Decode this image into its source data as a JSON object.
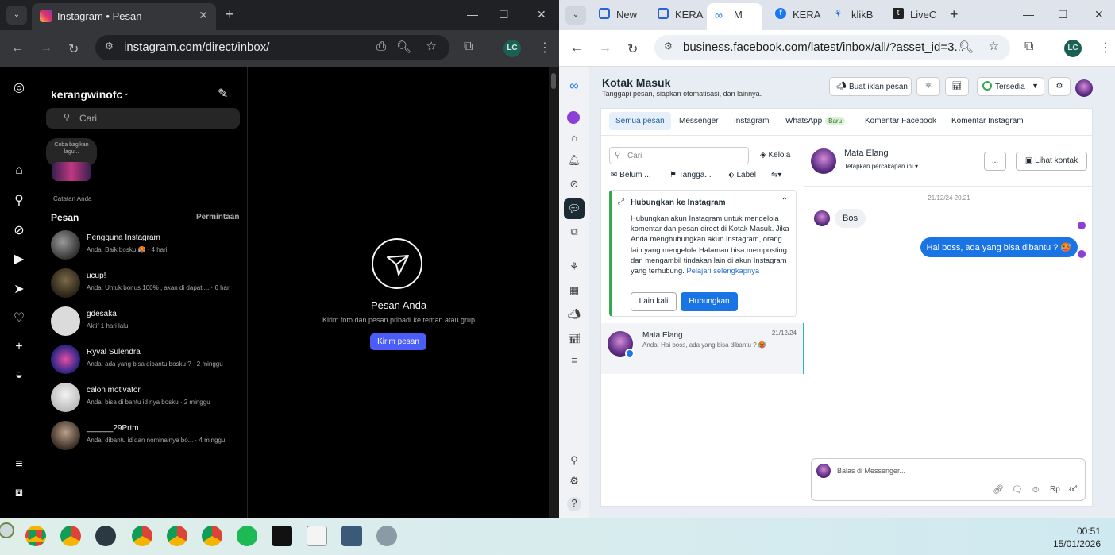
{
  "left_browser": {
    "tab_title": "Instagram • Pesan",
    "url": "instagram.com/direct/inbox/",
    "profile_initials": "LC"
  },
  "instagram": {
    "username": "kerangwinofc",
    "search_placeholder": "Cari",
    "note_bubble": "Coba bagikan lagu...",
    "note_label": "Catatan Anda",
    "messages_header": "Pesan",
    "requests_label": "Permintaan",
    "threads": [
      {
        "name": "Pengguna Instagram",
        "preview": "Anda: Baik bosku 🥵 · 4 hari"
      },
      {
        "name": "ucup!",
        "preview": "Anda: Untuk bonus 100% , akan di dapat ... · 6 hari"
      },
      {
        "name": "gdesaka",
        "preview": "Aktif 1 hari lalu"
      },
      {
        "name": "Ryval Sulendra",
        "preview": "Anda: ada yang bisa dibantu bosku ? · 2 minggu"
      },
      {
        "name": "calon motivator",
        "preview": "Anda: bisa di bantu id nya bosku · 2 minggu"
      },
      {
        "name": "______29Prtm",
        "preview": "Anda: dibantu id dan nominalnya bo... · 4 minggu"
      }
    ],
    "empty_title": "Pesan Anda",
    "empty_desc": "Kirim foto dan pesan pribadi ke teman atau grup",
    "send_button": "Kirim pesan"
  },
  "right_browser": {
    "tabs": [
      "New",
      "KERA",
      "M",
      "KERA",
      "klikB",
      "LiveC"
    ],
    "url": "business.facebook.com/latest/inbox/all/?asset_id=3...",
    "profile_initials": "LC"
  },
  "fb": {
    "title": "Kotak Masuk",
    "subtitle": "Tanggapi pesan, siapkan otomatisasi, dan lainnya.",
    "ad_button": "Buat iklan pesan",
    "status": "Tersedia",
    "tabs": [
      "Semua pesan",
      "Messenger",
      "Instagram",
      "WhatsApp",
      "Komentar Facebook",
      "Komentar Instagram"
    ],
    "baru": "Baru",
    "search_placeholder": "Cari",
    "kelola": "Kelola",
    "filters": [
      "Belum ...",
      "Tangga...",
      "Label"
    ],
    "connect_title": "Hubungkan ke Instagram",
    "connect_body": "Hubungkan akun Instagram untuk mengelola komentar dan pesan direct di Kotak Masuk. Jika Anda menghubungkan akun Instagram, orang lain yang mengelola Halaman bisa memposting dan mengambil tindakan lain di akun Instagram yang terhubung.",
    "connect_link": "Pelajari selengkapnya",
    "later_button": "Lain kali",
    "connect_button": "Hubungkan",
    "conversation": {
      "name": "Mata Elang",
      "preview": "Anda: Hai boss, ada yang bisa dibantu ? 🥵",
      "date": "21/12/24"
    },
    "chat_name": "Mata Elang",
    "chat_sub": "Tetapkan percakapan ini",
    "more_button": "...",
    "contact_button": "Lihat kontak",
    "timestamp": "21/12/24 20.21",
    "msg_in": "Bos",
    "msg_out": "Hai boss, ada yang bisa dibantu ? 🥵",
    "reply_placeholder": "Balas di Messenger...",
    "rp": "Rp"
  },
  "clock": {
    "time": "00:51",
    "date": "15/01/2026"
  }
}
